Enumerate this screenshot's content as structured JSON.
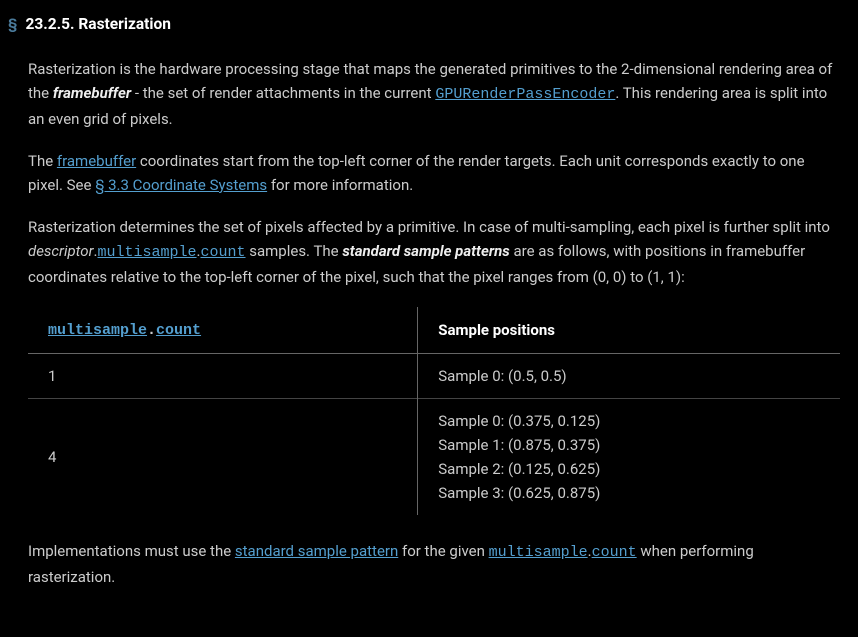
{
  "heading": {
    "marker": "§",
    "number": "23.2.5.",
    "title": "Rasterization"
  },
  "para1": {
    "t1": "Rasterization is the hardware processing stage that maps the generated primitives to the 2-dimensional rendering area of the ",
    "framebuffer": "framebuffer",
    "t2": " - the set of render attachments in the current ",
    "encoder": "GPURenderPassEncoder",
    "t3": ". This rendering area is split into an even grid of pixels."
  },
  "para2": {
    "t1": "The ",
    "framebuffer_link": "framebuffer",
    "t2": " coordinates start from the top-left corner of the render targets. Each unit corresponds exactly to one pixel. See ",
    "coord_link": "§ 3.3 Coordinate Systems",
    "t3": " for more information."
  },
  "para3": {
    "t1": "Rasterization determines the set of pixels affected by a primitive. In case of multi-sampling, each pixel is further split into ",
    "descriptor": "descriptor",
    "dot1": ".",
    "multisample": "multisample",
    "dot2": ".",
    "count": "count",
    "t2": " samples. The ",
    "ssp": "standard sample patterns",
    "t3": " are as follows, with positions in framebuffer coordinates relative to the top-left corner of the pixel, such that the pixel ranges from (0, 0) to (1, 1):"
  },
  "table": {
    "header": {
      "col1_multisample": "multisample",
      "col1_dot": ".",
      "col1_count": "count",
      "col2": "Sample positions"
    },
    "rows": [
      {
        "count": "1",
        "samples": [
          "Sample 0: (0.5, 0.5)"
        ]
      },
      {
        "count": "4",
        "samples": [
          "Sample 0: (0.375, 0.125)",
          "Sample 1: (0.875, 0.375)",
          "Sample 2: (0.125, 0.625)",
          "Sample 3: (0.625, 0.875)"
        ]
      }
    ]
  },
  "para4": {
    "t1": "Implementations must use the ",
    "ssp_link": "standard sample pattern",
    "t2": " for the given ",
    "multisample": "multisample",
    "dot": ".",
    "count": "count",
    "t3": " when performing rasterization."
  }
}
